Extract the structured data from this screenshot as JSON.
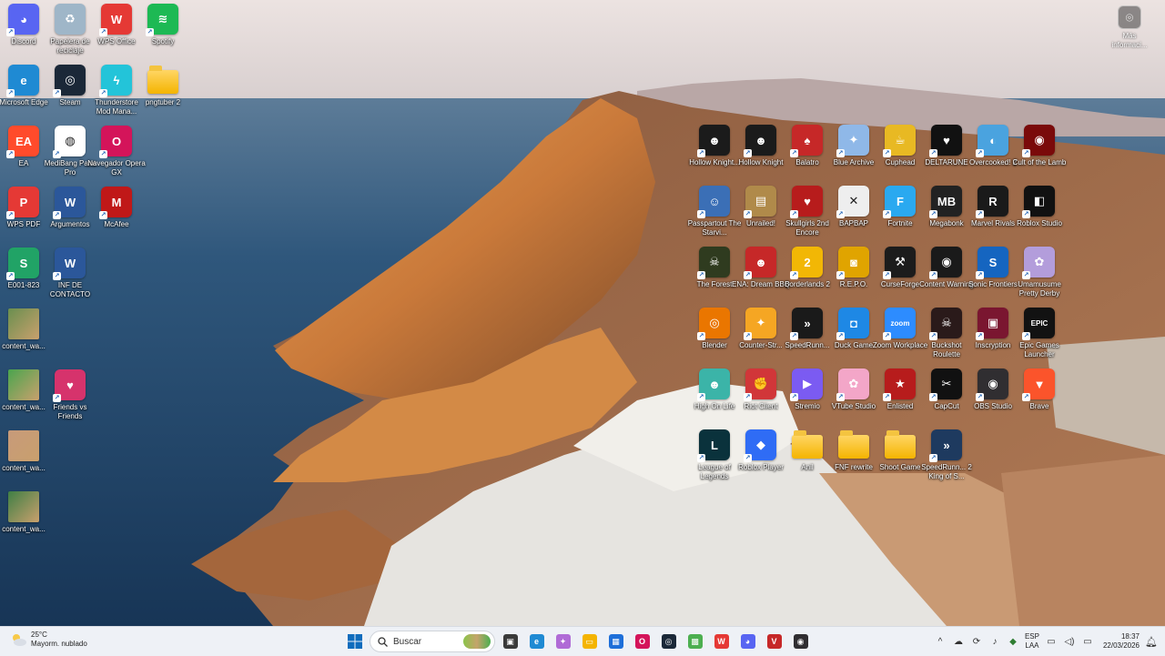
{
  "desktop_left": [
    {
      "label": "Discord",
      "icon": "discord-icon",
      "color": "#5865F2",
      "glyph": "◕"
    },
    {
      "label": "Papelera de reciclaje",
      "icon": "recycle-bin-icon",
      "color": "#9fb6c8",
      "glyph": "♻"
    },
    {
      "label": "WPS Office",
      "icon": "wps-office-icon",
      "color": "#e53935",
      "glyph": "W"
    },
    {
      "label": "Spotify",
      "icon": "spotify-icon",
      "color": "#1DB954",
      "glyph": "≋"
    },
    {
      "label": "Microsoft Edge",
      "icon": "edge-icon",
      "color": "#1f8ad3",
      "glyph": "e"
    },
    {
      "label": "Steam",
      "icon": "steam-icon",
      "color": "#1b2838",
      "glyph": "◎"
    },
    {
      "label": "Thunderstore Mod Mana...",
      "icon": "thunderstore-icon",
      "color": "#23c4d9",
      "glyph": "ϟ"
    },
    {
      "label": "pngtuber 2",
      "icon": "folder-icon",
      "color": "#f4b400",
      "glyph": ""
    },
    {
      "label": "EA",
      "icon": "ea-icon",
      "color": "#ff4b2b",
      "glyph": "EA"
    },
    {
      "label": "MediBang Paint Pro",
      "icon": "medibang-icon",
      "color": "#ffffff",
      "glyph": "◍"
    },
    {
      "label": "Navegador Opera GX",
      "icon": "opera-gx-icon",
      "color": "#d4145a",
      "glyph": "O"
    },
    {
      "label": "WPS PDF",
      "icon": "wps-pdf-icon",
      "color": "#e53935",
      "glyph": "P"
    },
    {
      "label": "Argumentos",
      "icon": "word-doc-icon",
      "color": "#2b579a",
      "glyph": "W"
    },
    {
      "label": "McAfee",
      "icon": "mcafee-icon",
      "color": "#c01818",
      "glyph": "M"
    },
    {
      "label": "E001-823",
      "icon": "spreadsheet-icon",
      "color": "#21a366",
      "glyph": "S"
    },
    {
      "label": "INF DE CONTACTO",
      "icon": "word-doc-icon",
      "color": "#2b579a",
      "glyph": "W"
    },
    {
      "label": "content_wa...",
      "icon": "image-file-icon",
      "color": "#6a8f4f",
      "glyph": ""
    },
    {
      "label": "content_wa...",
      "icon": "image-file-icon",
      "color": "#4aa54e",
      "glyph": ""
    },
    {
      "label": "Friends vs Friends",
      "icon": "friends-vs-friends-icon",
      "color": "#d6336c",
      "glyph": "♥"
    },
    {
      "label": "content_wa...",
      "icon": "image-file-icon",
      "color": "#c79a7a",
      "glyph": ""
    },
    {
      "label": "content_wa...",
      "icon": "image-file-icon",
      "color": "#3f7f45",
      "glyph": ""
    }
  ],
  "desktop_right": [
    {
      "label": "Hollow Knight...",
      "icon": "hollow-knight-icon",
      "color": "#1b1b1b",
      "glyph": "☻"
    },
    {
      "label": "Hollow Knight",
      "icon": "hollow-knight-icon",
      "color": "#1b1b1b",
      "glyph": "☻"
    },
    {
      "label": "Balatro",
      "icon": "balatro-icon",
      "color": "#c62828",
      "glyph": "♠"
    },
    {
      "label": "Blue Archive",
      "icon": "blue-archive-icon",
      "color": "#8fb8e8",
      "glyph": "✦"
    },
    {
      "label": "Cuphead",
      "icon": "cuphead-icon",
      "color": "#e8b923",
      "glyph": "☕"
    },
    {
      "label": "DELTARUNE",
      "icon": "deltarune-icon",
      "color": "#111111",
      "glyph": "♥"
    },
    {
      "label": "Overcooked! 2",
      "icon": "overcooked-icon",
      "color": "#4aa3df",
      "glyph": "◐"
    },
    {
      "label": "Cult of the Lamb",
      "icon": "cult-of-the-lamb-icon",
      "color": "#7a0a0a",
      "glyph": "◉"
    },
    {
      "label": "Passpartout The Starvi...",
      "icon": "passpartout-icon",
      "color": "#3b6fb6",
      "glyph": "☺"
    },
    {
      "label": "Unrailed!",
      "icon": "unrailed-icon",
      "color": "#b08a4a",
      "glyph": "▤"
    },
    {
      "label": "Skullgirls 2nd Encore",
      "icon": "skullgirls-icon",
      "color": "#b71c1c",
      "glyph": "♥"
    },
    {
      "label": "BAPBAP",
      "icon": "bapbap-icon",
      "color": "#eeeeee",
      "glyph": "✕"
    },
    {
      "label": "Fortnite",
      "icon": "fortnite-icon",
      "color": "#2aa9f0",
      "glyph": "F"
    },
    {
      "label": "Megabonk",
      "icon": "megabonk-icon",
      "color": "#222222",
      "glyph": "MB"
    },
    {
      "label": "Marvel Rivals",
      "icon": "marvel-rivals-icon",
      "color": "#1a1a1a",
      "glyph": "R"
    },
    {
      "label": "Roblox Studio",
      "icon": "roblox-studio-icon",
      "color": "#111111",
      "glyph": "◧"
    },
    {
      "label": "The Forest",
      "icon": "the-forest-icon",
      "color": "#2f3b1f",
      "glyph": "☠"
    },
    {
      "label": "ENA: Dream BBQ",
      "icon": "ena-dream-bbq-icon",
      "color": "#c62828",
      "glyph": "☻"
    },
    {
      "label": "Borderlands 2",
      "icon": "borderlands-icon",
      "color": "#f2b705",
      "glyph": "2"
    },
    {
      "label": "R.E.P.O.",
      "icon": "repo-icon",
      "color": "#e0a400",
      "glyph": "◙"
    },
    {
      "label": "CurseForge",
      "icon": "curseforge-icon",
      "color": "#1c1c1c",
      "glyph": "⚒"
    },
    {
      "label": "Content Warning",
      "icon": "content-warning-icon",
      "color": "#1a1a1a",
      "glyph": "◉"
    },
    {
      "label": "Sonic Frontiers",
      "icon": "sonic-frontiers-icon",
      "color": "#1565c0",
      "glyph": "S"
    },
    {
      "label": "Umamusume Pretty Derby",
      "icon": "umamusume-icon",
      "color": "#b39ddb",
      "glyph": "✿"
    },
    {
      "label": "Blender",
      "icon": "blender-icon",
      "color": "#ea7600",
      "glyph": "◎"
    },
    {
      "label": "Counter-Str...",
      "icon": "counter-strike-icon",
      "color": "#f5a623",
      "glyph": "✦"
    },
    {
      "label": "SpeedRunn...",
      "icon": "speedrunners-icon",
      "color": "#1a1a1a",
      "glyph": "»"
    },
    {
      "label": "Duck Game",
      "icon": "duck-game-icon",
      "color": "#1e88e5",
      "glyph": "◘"
    },
    {
      "label": "Zoom Workplace",
      "icon": "zoom-icon",
      "color": "#2d8cff",
      "glyph": "zoom"
    },
    {
      "label": "Buckshot Roulette",
      "icon": "buckshot-roulette-icon",
      "color": "#2a1a1a",
      "glyph": "☠"
    },
    {
      "label": "Inscryption",
      "icon": "inscryption-icon",
      "color": "#7a1630",
      "glyph": "▣"
    },
    {
      "label": "Epic Games Launcher",
      "icon": "epic-games-icon",
      "color": "#121212",
      "glyph": "EPIC"
    },
    {
      "label": "High On Life",
      "icon": "high-on-life-icon",
      "color": "#3bb4a8",
      "glyph": "☻"
    },
    {
      "label": "Riot Client",
      "icon": "riot-client-icon",
      "color": "#d13639",
      "glyph": "✊"
    },
    {
      "label": "Stremio",
      "icon": "stremio-icon",
      "color": "#7b5bf2",
      "glyph": "▶"
    },
    {
      "label": "VTube Studio",
      "icon": "vtube-studio-icon",
      "color": "#f3a6c8",
      "glyph": "✿"
    },
    {
      "label": "Enlisted",
      "icon": "enlisted-icon",
      "color": "#b71c1c",
      "glyph": "★"
    },
    {
      "label": "CapCut",
      "icon": "capcut-icon",
      "color": "#111111",
      "glyph": "✂"
    },
    {
      "label": "OBS Studio",
      "icon": "obs-studio-icon",
      "color": "#302e31",
      "glyph": "◉"
    },
    {
      "label": "Brave",
      "icon": "brave-icon",
      "color": "#fb542b",
      "glyph": "▼"
    },
    {
      "label": "League of Legends",
      "icon": "league-of-legends-icon",
      "color": "#0a323c",
      "glyph": "L"
    },
    {
      "label": "Roblox Player",
      "icon": "roblox-player-icon",
      "color": "#2f6cf5",
      "glyph": "◆"
    },
    {
      "label": "Anil",
      "icon": "folder-icon",
      "color": "#f4b400",
      "glyph": ""
    },
    {
      "label": "FNF rewrite",
      "icon": "folder-icon",
      "color": "#f4b400",
      "glyph": ""
    },
    {
      "label": "Shoot Game",
      "icon": "folder-icon",
      "color": "#f4b400",
      "glyph": ""
    },
    {
      "label": "SpeedRunn... 2 King of S...",
      "icon": "speedrunners-2-icon",
      "color": "#1e3a5f",
      "glyph": "»"
    }
  ],
  "info_widget": {
    "label": "Más informaci...",
    "icon": "info-camera-icon"
  },
  "taskbar": {
    "weather": {
      "temp": "25°C",
      "desc": "Mayorm. nublado"
    },
    "search_placeholder": "Buscar",
    "apps": [
      {
        "name": "task-view-icon",
        "color": "#3a3a3a",
        "glyph": "▣"
      },
      {
        "name": "edge-icon",
        "color": "#1f8ad3",
        "glyph": "e"
      },
      {
        "name": "copilot-icon",
        "color": "#b06bd6",
        "glyph": "✦"
      },
      {
        "name": "file-explorer-icon",
        "color": "#f4b400",
        "glyph": "▭"
      },
      {
        "name": "microsoft-store-icon",
        "color": "#1e6fd9",
        "glyph": "▦"
      },
      {
        "name": "opera-gx-icon",
        "color": "#d4145a",
        "glyph": "O"
      },
      {
        "name": "steam-icon",
        "color": "#1b2838",
        "glyph": "◎"
      },
      {
        "name": "minecraft-icon",
        "color": "#4caf50",
        "glyph": "▩"
      },
      {
        "name": "wps-office-icon",
        "color": "#e53935",
        "glyph": "W"
      },
      {
        "name": "discord-icon",
        "color": "#5865F2",
        "glyph": "◕"
      },
      {
        "name": "valorant-icon",
        "color": "#c62828",
        "glyph": "V"
      },
      {
        "name": "obs-studio-icon",
        "color": "#302e31",
        "glyph": "◉"
      }
    ],
    "tray": {
      "icons": [
        "chevron-up-icon",
        "cloud-icon",
        "sync-icon",
        "microphone-icon",
        "game-icon"
      ],
      "lang_top": "ESP",
      "lang_bottom": "LAA",
      "time": "18:37",
      "date": "22/03/2026"
    }
  }
}
